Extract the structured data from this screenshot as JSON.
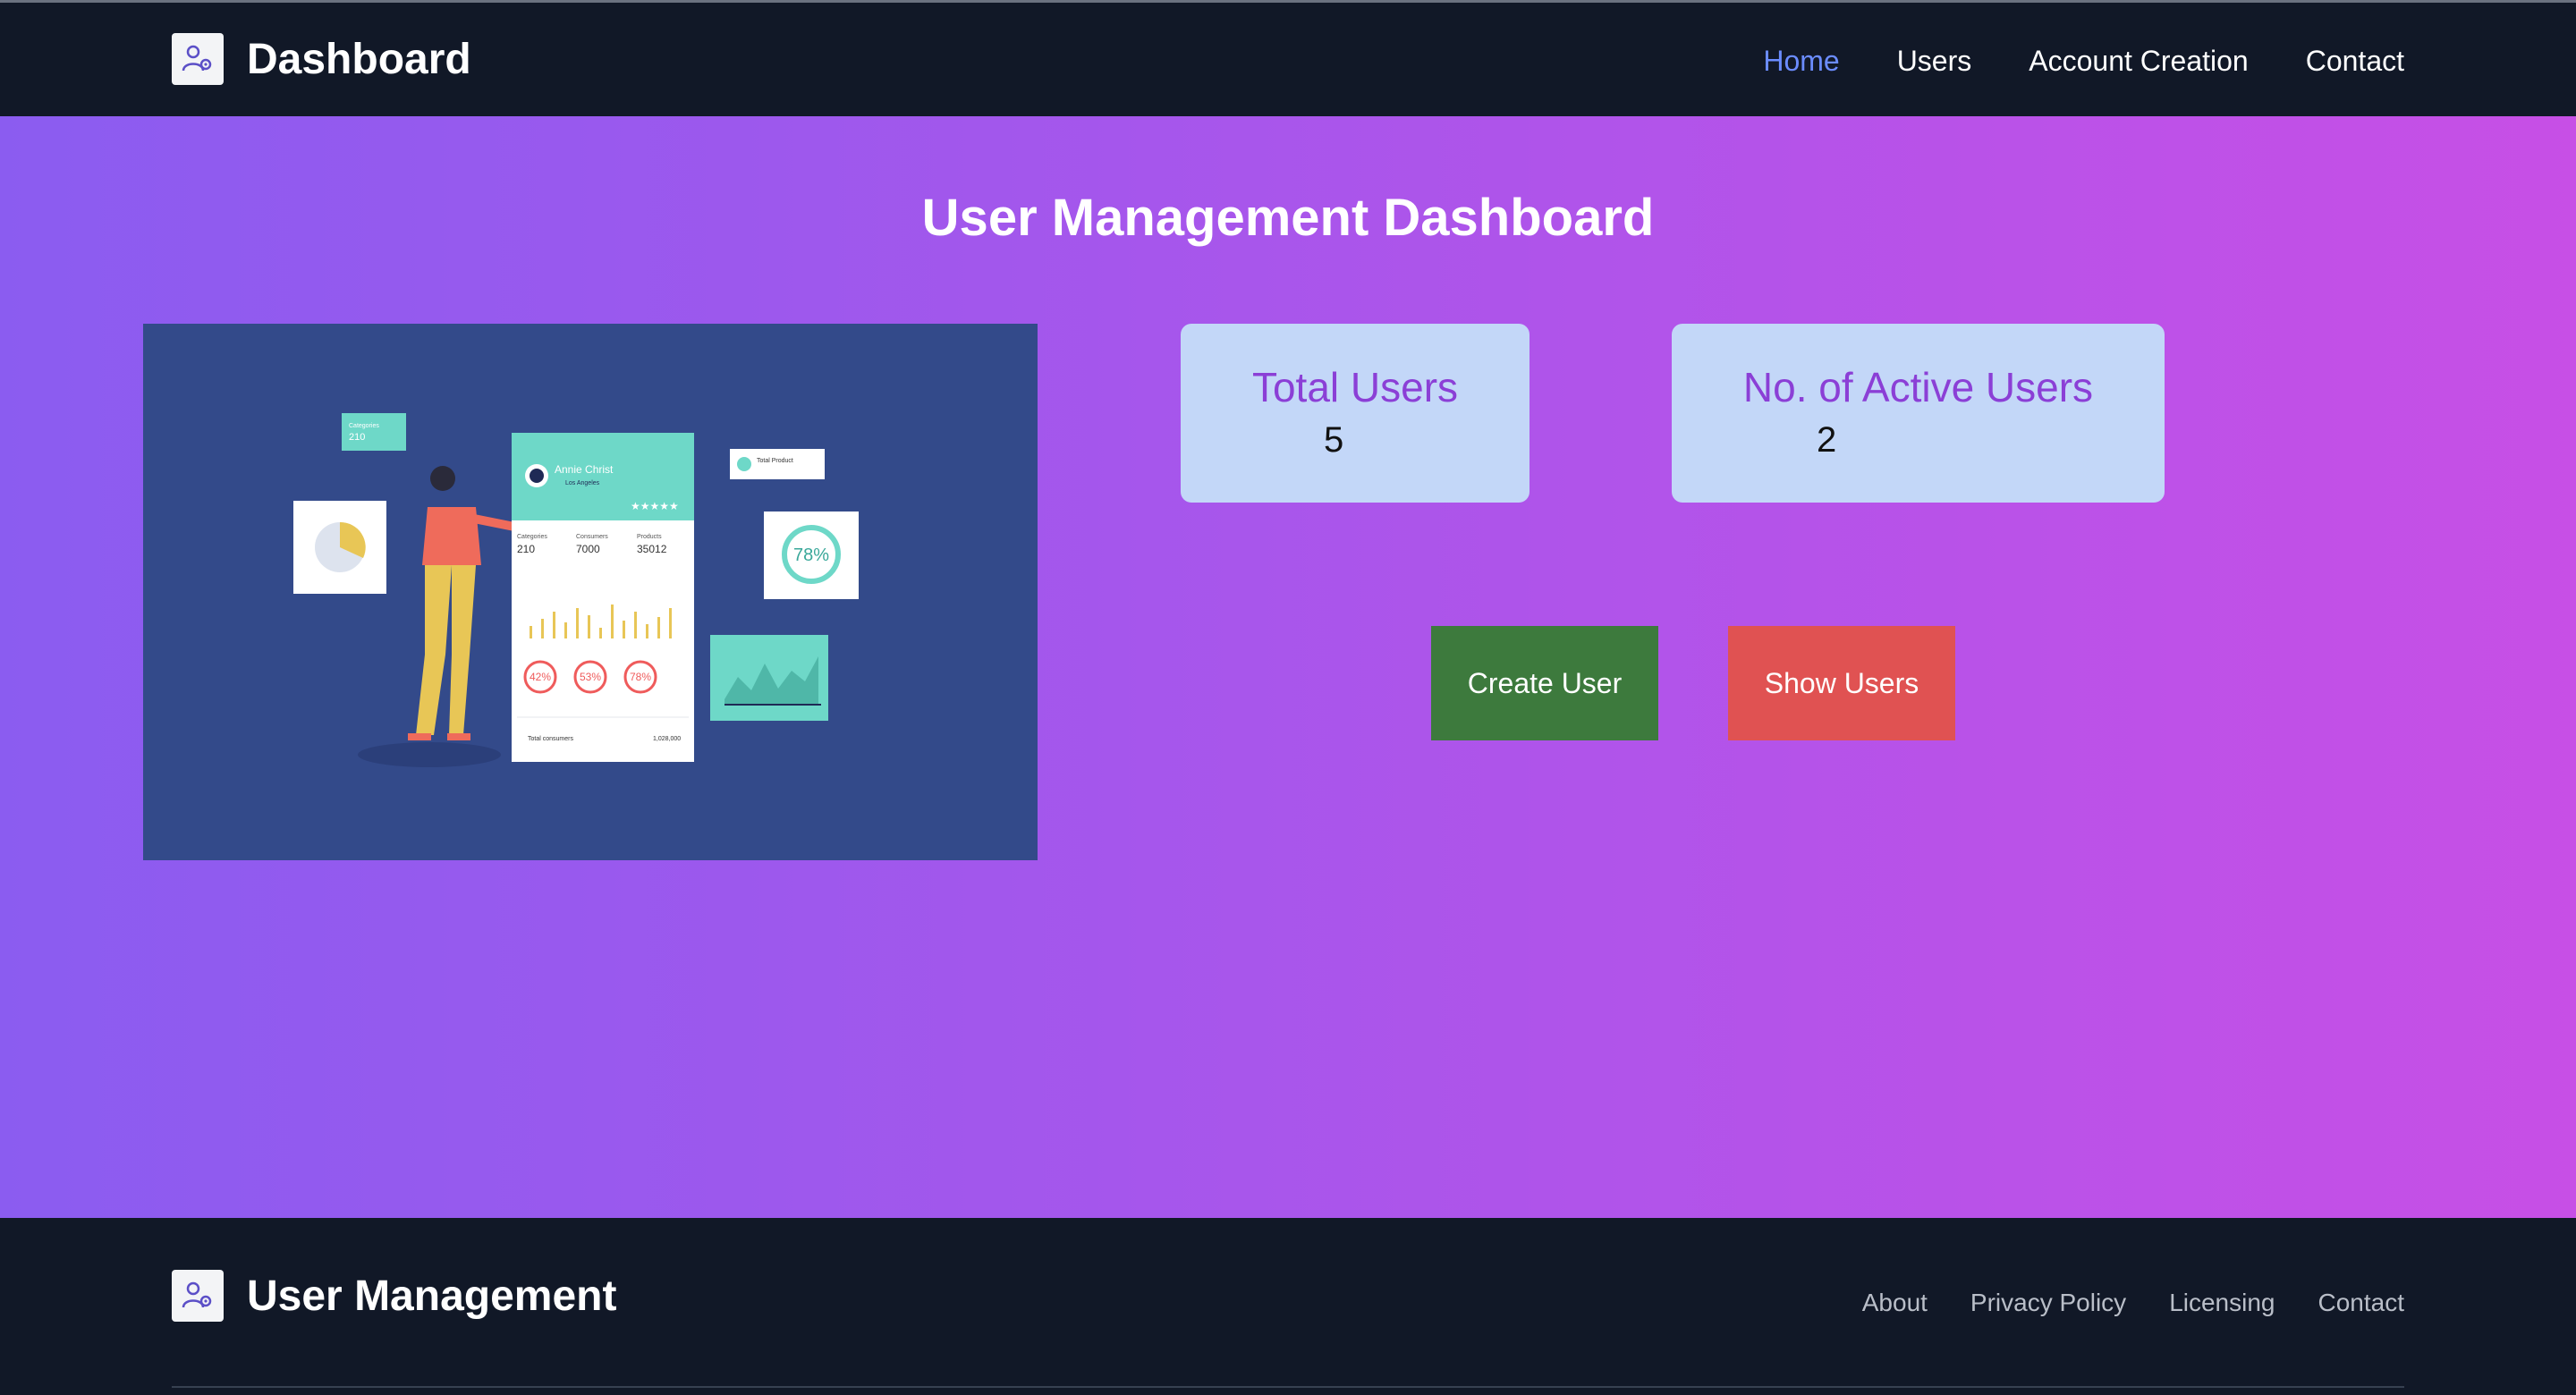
{
  "navbar": {
    "logo_icon": "user-gear-icon",
    "title": "Dashboard",
    "links": [
      {
        "label": "Home",
        "active": true
      },
      {
        "label": "Users",
        "active": false
      },
      {
        "label": "Account Creation",
        "active": false
      },
      {
        "label": "Contact",
        "active": false
      }
    ]
  },
  "main": {
    "title": "User Management Dashboard",
    "illustration": {
      "profile_name": "Annie Christ",
      "profile_location": "Los Angeles",
      "categories_label": "Categories",
      "categories_value": "210",
      "consumers_label": "Consumers",
      "consumers_value": "7000",
      "products_label": "Products",
      "products_value": "35012",
      "gauge_values": [
        "42%",
        "53%",
        "78%"
      ],
      "big_gauge_value": "78%",
      "total_consumers_label": "Total consumers",
      "total_consumers_value": "1,028,000",
      "small_card_label": "Categories",
      "small_card_value": "210",
      "total_product_label": "Total Product"
    },
    "stats": [
      {
        "label": "Total Users",
        "value": "5"
      },
      {
        "label": "No. of Active Users",
        "value": "2"
      }
    ],
    "buttons": {
      "create": "Create User",
      "show": "Show Users"
    }
  },
  "footer": {
    "logo_icon": "user-gear-icon",
    "title": "User Management",
    "links": [
      "About",
      "Privacy Policy",
      "Licensing",
      "Contact"
    ]
  },
  "colors": {
    "nav_bg": "#111827",
    "active_link": "#6b8cff",
    "gradient_start": "#8b5cf0",
    "gradient_end": "#c74fe6",
    "card_bg": "#c3d7f8",
    "card_label": "#8b3fd6",
    "create_button": "#3d7a3d",
    "show_button": "#e05252"
  }
}
